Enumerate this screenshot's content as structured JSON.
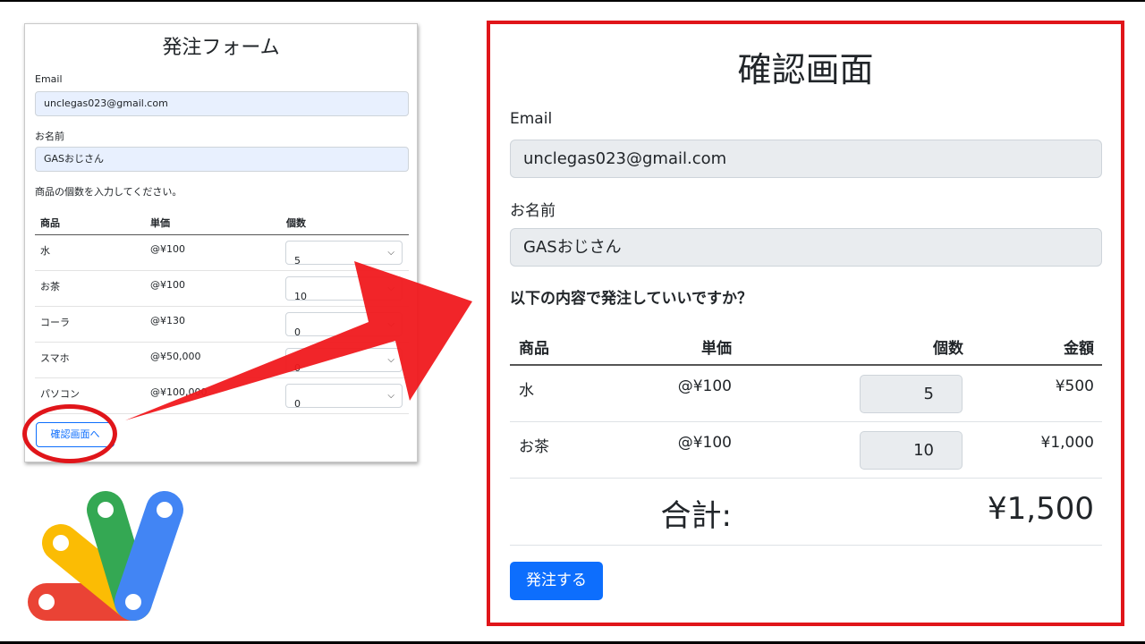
{
  "order_form": {
    "title": "発注フォーム",
    "email_label": "Email",
    "email_value": "unclegas023@gmail.com",
    "name_label": "お名前",
    "name_value": "GASおじさん",
    "instruction": "商品の個数を入力してください。",
    "headers": [
      "商品",
      "単価",
      "個数"
    ],
    "rows": [
      {
        "product": "水",
        "price": "@¥100",
        "qty": "5"
      },
      {
        "product": "お茶",
        "price": "@¥100",
        "qty": "10"
      },
      {
        "product": "コーラ",
        "price": "@¥130",
        "qty": "0"
      },
      {
        "product": "スマホ",
        "price": "@¥50,000",
        "qty": "0"
      },
      {
        "product": "パソコン",
        "price": "@¥100,000",
        "qty": "0"
      }
    ],
    "confirm_button": "確認画面へ"
  },
  "confirmation": {
    "title": "確認画面",
    "email_label": "Email",
    "email_value": "unclegas023@gmail.com",
    "name_label": "お名前",
    "name_value": "GASおじさん",
    "question": "以下の内容で発注していいですか？",
    "headers": [
      "商品",
      "単価",
      "個数",
      "金額"
    ],
    "rows": [
      {
        "product": "水",
        "price": "@¥100",
        "qty": "5",
        "amount": "¥500"
      },
      {
        "product": "お茶",
        "price": "@¥100",
        "qty": "10",
        "amount": "¥1,000"
      }
    ],
    "total_label": "合計:",
    "total_value": "¥1,500",
    "order_button": "発注する"
  },
  "colors": {
    "highlight_red": "#e0151a",
    "primary_blue": "#0d6efd",
    "autofill_blue": "#e8f0fe",
    "readonly_gray": "#e9ecef"
  },
  "icons": {
    "arrow": "right-arrow-icon",
    "logo": "apps-script-logo"
  }
}
